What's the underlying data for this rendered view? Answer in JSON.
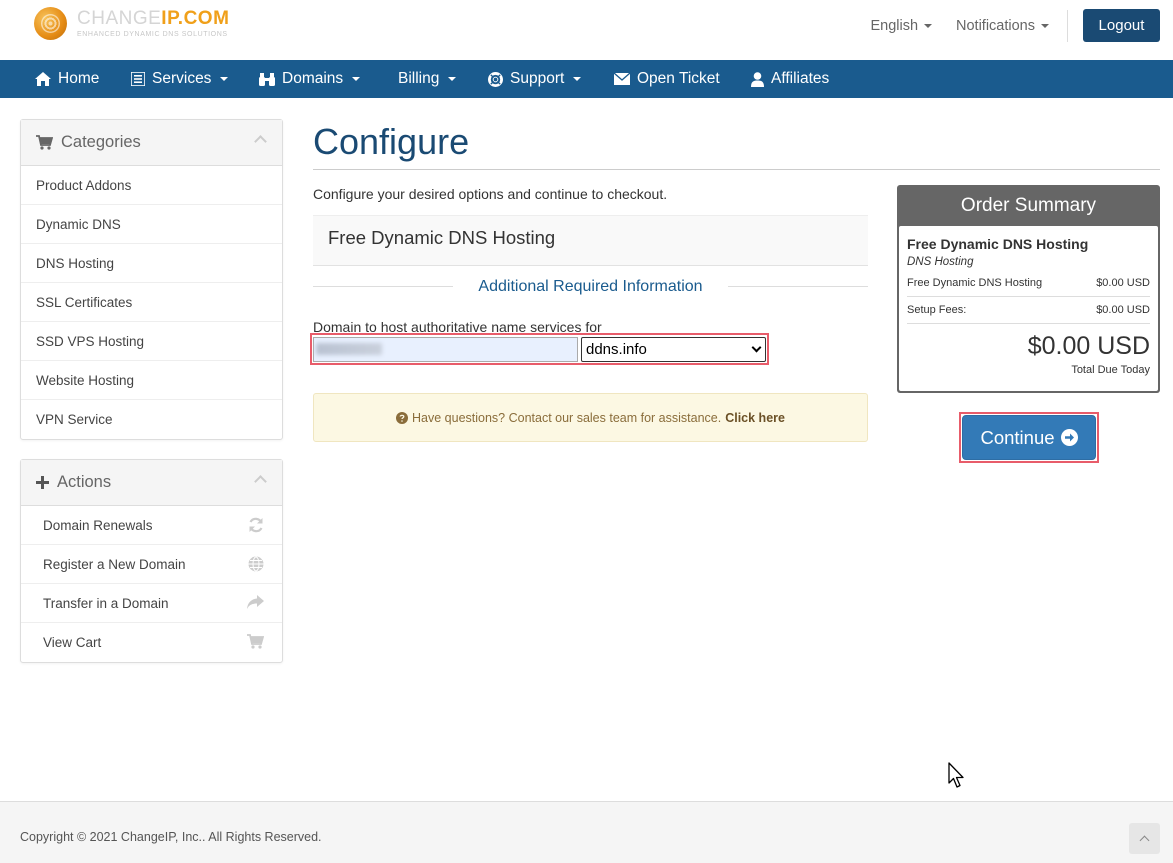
{
  "brand": {
    "name_a": "CHANGE",
    "name_b": "IP.COM",
    "tagline": "ENHANCED DYNAMIC DNS SOLUTIONS"
  },
  "header": {
    "language": "English",
    "notifications": "Notifications",
    "logout": "Logout"
  },
  "nav": {
    "items": [
      {
        "label": "Home"
      },
      {
        "label": "Services"
      },
      {
        "label": "Domains"
      },
      {
        "label": "Billing"
      },
      {
        "label": "Support"
      },
      {
        "label": "Open Ticket"
      },
      {
        "label": "Affiliates"
      }
    ]
  },
  "sidebar": {
    "categories": {
      "title": "Categories",
      "items": [
        {
          "label": "Product Addons"
        },
        {
          "label": "Dynamic DNS"
        },
        {
          "label": "DNS Hosting"
        },
        {
          "label": "SSL Certificates"
        },
        {
          "label": "SSD VPS Hosting"
        },
        {
          "label": "Website Hosting"
        },
        {
          "label": "VPN Service"
        }
      ]
    },
    "actions": {
      "title": "Actions",
      "items": [
        {
          "label": "Domain Renewals",
          "icon": "refresh-icon"
        },
        {
          "label": "Register a New Domain",
          "icon": "globe-icon"
        },
        {
          "label": "Transfer in a Domain",
          "icon": "share-icon"
        },
        {
          "label": "View Cart",
          "icon": "cart-icon"
        }
      ]
    }
  },
  "main": {
    "title": "Configure",
    "intro": "Configure your desired options and continue to checkout.",
    "product_name": "Free Dynamic DNS Hosting",
    "section_heading": "Additional Required Information",
    "domain_field": {
      "label": "Domain to host authoritative name services for",
      "tld_selected": "ddns.info"
    },
    "help": {
      "text": "Have questions? Contact our sales team for assistance.",
      "link": "Click here"
    }
  },
  "summary": {
    "title": "Order Summary",
    "product": "Free Dynamic DNS Hosting",
    "group": "DNS Hosting",
    "rows": [
      {
        "label": "Free Dynamic DNS Hosting",
        "value": "$0.00 USD"
      },
      {
        "label": "Setup Fees:",
        "value": "$0.00 USD"
      }
    ],
    "total": "$0.00 USD",
    "total_label": "Total Due Today",
    "continue": "Continue"
  },
  "footer": {
    "copyright": "Copyright © 2021 ChangeIP, Inc.. All Rights Reserved."
  },
  "colors": {
    "nav": "#1a5b8e",
    "logout": "#1a4a73",
    "accent": "#f0a01a",
    "button": "#337ab7",
    "highlight": "#e85c6a"
  }
}
